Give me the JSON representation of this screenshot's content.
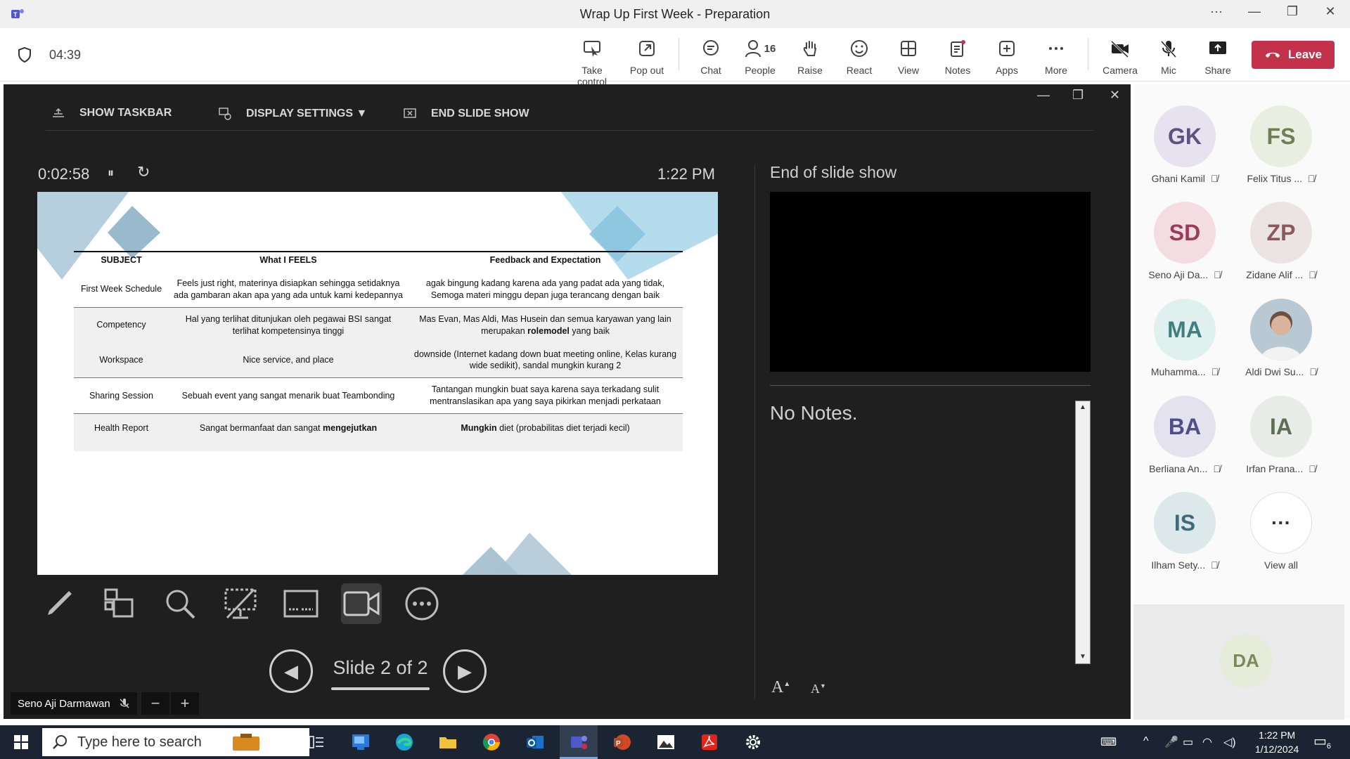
{
  "window": {
    "title": "Wrap Up First Week - Preparation",
    "more": "···",
    "minimize": "—",
    "restore": "❐",
    "close": "✕"
  },
  "meeting": {
    "elapsed": "04:39"
  },
  "toolbar": {
    "take_control": "Take control",
    "pop_out": "Pop out",
    "chat": "Chat",
    "people": "People",
    "people_count": "16",
    "raise": "Raise",
    "react": "React",
    "view": "View",
    "notes": "Notes",
    "apps": "Apps",
    "more": "More",
    "camera": "Camera",
    "mic": "Mic",
    "share": "Share",
    "leave": "Leave"
  },
  "presenter": {
    "show_taskbar": "SHOW TASKBAR",
    "display_settings": "DISPLAY SETTINGS ▼",
    "end_slide_show": "END SLIDE SHOW",
    "elapsed": "0:02:58",
    "time": "1:22 PM",
    "slide_counter": "Slide 2 of 2",
    "next_label": "End of slide show",
    "notes": "No Notes.",
    "font_up": "A",
    "font_down": "A",
    "pause_icon": "⏸",
    "reset_icon": "↻"
  },
  "slide": {
    "headers": [
      "SUBJECT",
      "What I FEELS",
      "Feedback and Expectation"
    ],
    "rows": [
      {
        "subject": "First Week Schedule",
        "feel": "Feels just right, materinya disiapkan sehingga setidaknya ada gambaran akan apa yang ada untuk kami kedepannya",
        "feedback": "agak bingung kadang karena ada yang padat ada yang tidak, Semoga materi minggu depan juga terancang dengan baik"
      },
      {
        "subject": "Competency",
        "feel": "Hal yang terlihat ditunjukan oleh pegawai BSI sangat terlihat kompetensinya tinggi",
        "feedback_pre": "Mas Evan, Mas Aldi, Mas Husein dan semua karyawan yang lain merupakan ",
        "feedback_bold": "rolemodel",
        "feedback_post": " yang baik"
      },
      {
        "subject": "Workspace",
        "feel": "Nice service, and place",
        "feedback": "downside (Internet kadang down buat meeting online, Kelas kurang wide sedikit), sandal mungkin kurang 2"
      },
      {
        "subject": "Sharing Session",
        "feel": "Sebuah event yang sangat menarik buat Teambonding",
        "feedback": "Tantangan mungkin buat saya karena saya terkadang sulit mentranslasikan apa yang saya pikirkan menjadi perkataan"
      },
      {
        "subject": "Health Report",
        "feel_pre": "Sangat bermanfaat dan sangat ",
        "feel_bold": "mengejutkan",
        "feedback_bold": "Mungkin",
        "feedback_post": " diet (probabilitas diet terjadi kecil)"
      }
    ]
  },
  "stage_footer": {
    "speaker": "Seno Aji Darmawan",
    "zoom_out": "−",
    "zoom_in": "+"
  },
  "participants": [
    {
      "initials": "GK",
      "name": "Ghani Kamil",
      "bg": "#e6e2ef",
      "fg": "#5b5480"
    },
    {
      "initials": "FS",
      "name": "Felix Titus ...",
      "bg": "#e8eee0",
      "fg": "#6d7f55"
    },
    {
      "initials": "SD",
      "name": "Seno Aji Da...",
      "bg": "#f4dce3",
      "fg": "#9c3c5a"
    },
    {
      "initials": "ZP",
      "name": "Zidane Alif ...",
      "bg": "#ece3e3",
      "fg": "#8a5a5a"
    },
    {
      "initials": "MA",
      "name": "Muhamma...",
      "bg": "#dff0ef",
      "fg": "#3f7f80"
    },
    {
      "initials": "",
      "name": "Aldi Dwi Su...",
      "bg": "#c9d6e0",
      "fg": "#333"
    },
    {
      "initials": "BA",
      "name": "Berliana An...",
      "bg": "#e5e2ef",
      "fg": "#4e4f8a"
    },
    {
      "initials": "IA",
      "name": "Irfan Prana...",
      "bg": "#e8ece6",
      "fg": "#5e6e56"
    },
    {
      "initials": "IS",
      "name": "Ilham Sety...",
      "bg": "#dde8ea",
      "fg": "#3f6c78"
    },
    {
      "initials": "···",
      "name": "View all",
      "bg": "#ffffff",
      "fg": "#333"
    }
  ],
  "self_view": {
    "initials": "DA"
  },
  "taskbar": {
    "search_placeholder": "Type here to search",
    "time": "1:22 PM",
    "date": "1/12/2024",
    "notif_count": "6"
  }
}
